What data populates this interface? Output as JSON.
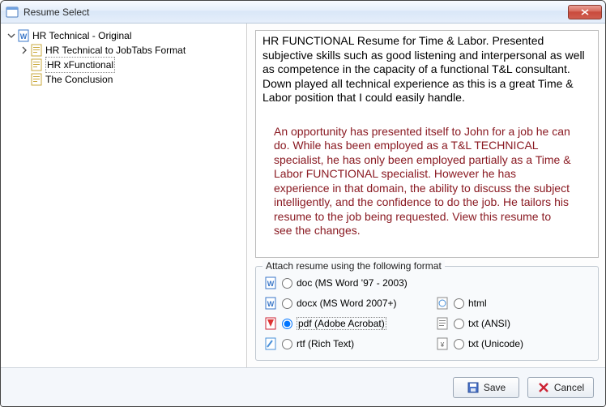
{
  "window": {
    "title": "Resume Select"
  },
  "tree": {
    "root": {
      "label": "HR Technical - Original",
      "children": [
        {
          "label": "HR Technical to JobTabs Format",
          "expandable": true,
          "selected": false
        },
        {
          "label": "HR xFunctional",
          "expandable": false,
          "selected": true
        },
        {
          "label": "The Conclusion",
          "expandable": false,
          "selected": false
        }
      ]
    }
  },
  "description": {
    "summary": "HR FUNCTIONAL Resume for Time & Labor.  Presented subjective skills such as good listening and interpersonal as well as competence in the capacity of a functional T&L consultant.  Down played all technical experience as this is a great Time & Labor position that I could easily handle.",
    "body": "An opportunity has presented itself to John for a job he can do.  While has been employed as a T&L TECHNICAL specialist, he has only been employed partially as a Time & Labor FUNCTIONAL specialist.  However he has experience in that domain, the ability to discuss the subject intelligently, and the confidence to do the job.  He tailors his resume to the job being requested.  View this resume to see the changes."
  },
  "format": {
    "legend": "Attach resume using the following format",
    "options": {
      "doc": {
        "label": "doc (MS Word '97 - 2003)",
        "checked": false
      },
      "docx": {
        "label": "docx (MS Word 2007+)",
        "checked": false
      },
      "html": {
        "label": "html",
        "checked": false
      },
      "pdf": {
        "label": "pdf (Adobe Acrobat)",
        "checked": true
      },
      "txt_ansi": {
        "label": "txt (ANSI)",
        "checked": false
      },
      "rtf": {
        "label": "rtf (Rich Text)",
        "checked": false
      },
      "txt_unicode": {
        "label": "txt (Unicode)",
        "checked": false
      }
    }
  },
  "buttons": {
    "save": "Save",
    "cancel": "Cancel"
  }
}
